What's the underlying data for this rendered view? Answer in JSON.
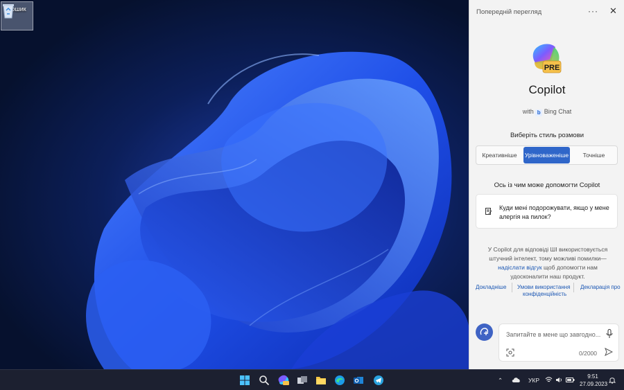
{
  "desktop": {
    "recycle_bin_label": "Кошик"
  },
  "panel": {
    "header_title": "Попередній перегляд",
    "more_icon": "ellipsis-icon",
    "close_icon": "close-icon",
    "logo_badge": "PRE",
    "app_name": "Copilot",
    "with_prefix": "with",
    "with_brand": "Bing Chat",
    "style_heading": "Виберіть стиль розмови",
    "styles": [
      "Креативніше",
      "Урівноваженіше",
      "Точніше"
    ],
    "active_style": "Урівноваженіше",
    "help_heading": "Ось із чим може допомогти Copilot",
    "suggestion": "Куди мені подорожувати, якщо у мене алергія на пилок?",
    "disclaimer_line1": "У Copilot для відповіді ШІ використовується штучний інтелект, тому можливі помилки—",
    "disclaimer_link": "надіслати відгук",
    "disclaimer_line2": "щоб допомогти нам удосконалити наш продукт.",
    "footer_links": [
      "Докладніше",
      "Умови використання",
      "конфіденційність",
      "Декларація про"
    ],
    "input_placeholder": "Запитайте в мене що завгодно...",
    "char_count": "0/2000"
  },
  "taskbar": {
    "apps": [
      "windows-start-icon",
      "search-icon",
      "copilot-icon",
      "task-view-icon",
      "file-explorer-icon",
      "edge-icon",
      "outlook-icon",
      "telegram-icon"
    ],
    "language": "УКР",
    "time": "9:51",
    "date": "27.09.2023"
  },
  "colors": {
    "accent": "#2f66c9",
    "panel_bg": "#f3f3f3",
    "taskbar_bg": "#1c2030",
    "link": "#1a56b3"
  }
}
